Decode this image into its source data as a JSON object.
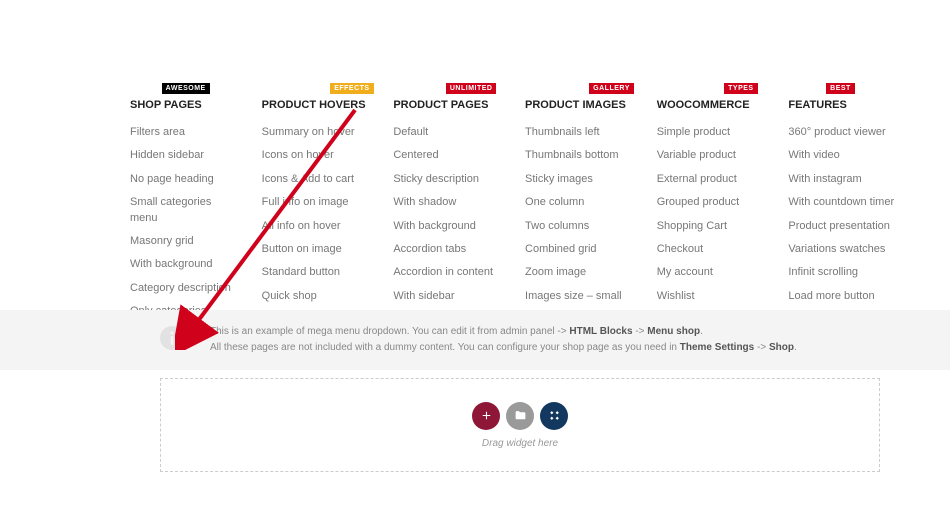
{
  "columns": [
    {
      "title": "SHOP PAGES",
      "badge": "AWESOME",
      "badgeClass": "badge-black",
      "items": [
        "Filters area",
        "Hidden sidebar",
        "No page heading",
        "Small categories menu",
        "Masonry grid",
        "With background",
        "Category description",
        "Only categories"
      ]
    },
    {
      "title": "PRODUCT HOVERS",
      "badge": "EFFECTS",
      "badgeClass": "badge-yellow",
      "items": [
        "Summary on hover",
        "Icons on hover",
        "Icons & Add to cart",
        "Full info on image",
        "All info on hover",
        "Button on image",
        "Standard button",
        "Quick shop"
      ]
    },
    {
      "title": "PRODUCT PAGES",
      "badge": "UNLIMITED",
      "badgeClass": "badge-red",
      "items": [
        "Default",
        "Centered",
        "Sticky description",
        "With shadow",
        "With background",
        "Accordion tabs",
        "Accordion in content",
        "With sidebar"
      ]
    },
    {
      "title": "PRODUCT IMAGES",
      "badge": "GALLERY",
      "badgeClass": "badge-red",
      "items": [
        "Thumbnails left",
        "Thumbnails bottom",
        "Sticky images",
        "One column",
        "Two columns",
        "Combined grid",
        "Zoom image",
        "Images size – small"
      ]
    },
    {
      "title": "WOOCOMMERCE",
      "badge": "TYPES",
      "badgeClass": "badge-red",
      "items": [
        "Simple product",
        "Variable product",
        "External product",
        "Grouped product",
        "Shopping Cart",
        "Checkout",
        "My account",
        "Wishlist"
      ]
    },
    {
      "title": "FEATURES",
      "badge": "BEST",
      "badgeClass": "badge-red",
      "items": [
        "360° product viewer",
        "With video",
        "With instagram",
        "With countdown timer",
        "Product presentation",
        "Variations swatches",
        "Infinit scrolling",
        "Load more button"
      ]
    }
  ],
  "info": {
    "line1_pre": "This is an example of mega menu dropdown. You can edit it from admin panel -> ",
    "line1_b1": "HTML Blocks",
    "line1_mid": " -> ",
    "line1_b2": "Menu shop",
    "line1_post": ".",
    "line2_pre": "All these pages are not included with a dummy content. You can configure your shop page as you need in ",
    "line2_b1": "Theme Settings",
    "line2_mid": " -> ",
    "line2_b2": "Shop",
    "line2_post": "."
  },
  "widget": {
    "hint": "Drag widget here"
  }
}
